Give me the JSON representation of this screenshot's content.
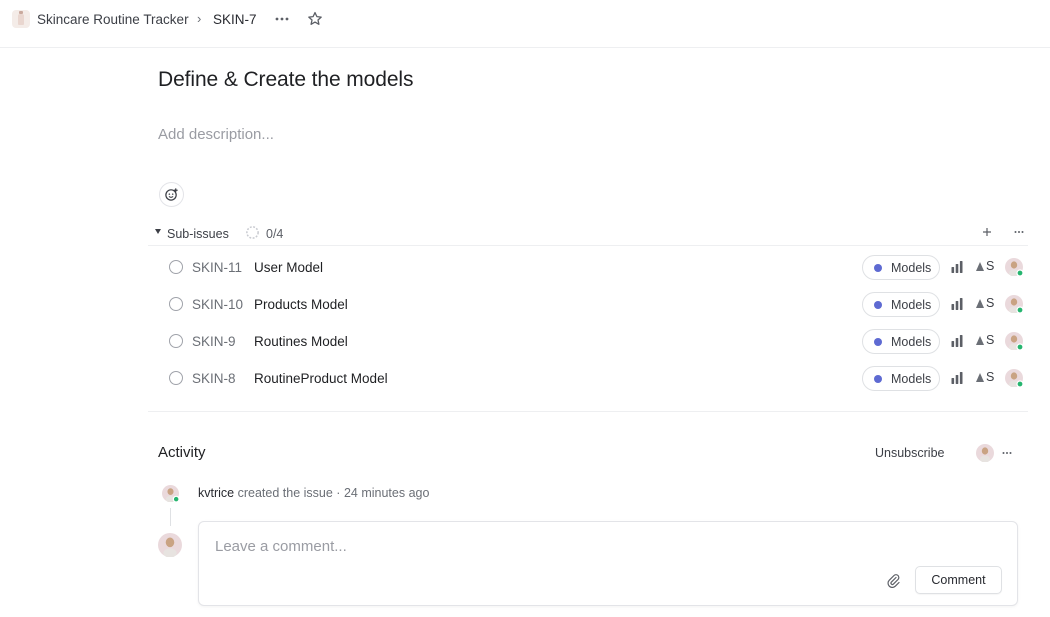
{
  "breadcrumb": {
    "project": "Skincare Routine Tracker",
    "separator": "›",
    "issue_key": "SKIN-7"
  },
  "icons": {
    "project": "skincare-bottle-icon",
    "more": "more-horizontal-icon",
    "favorite": "star-icon",
    "reaction": "add-reaction-icon",
    "progress": "progress-ring-icon",
    "add": "plus-icon",
    "priority": "priority-bars-icon",
    "estimate": "estimate-icon",
    "attach": "paperclip-icon"
  },
  "issue": {
    "title": "Define & Create the models",
    "description_placeholder": "Add description..."
  },
  "sub_issues": {
    "label": "Sub-issues",
    "count": "0/4",
    "progress": 0,
    "items": [
      {
        "key": "SKIN-11",
        "title": "User Model",
        "label": "Models",
        "estimate": "S"
      },
      {
        "key": "SKIN-10",
        "title": "Products Model",
        "label": "Models",
        "estimate": "S"
      },
      {
        "key": "SKIN-9",
        "title": "Routines Model",
        "label": "Models",
        "estimate": "S"
      },
      {
        "key": "SKIN-8",
        "title": "RoutineProduct Model",
        "label": "Models",
        "estimate": "S"
      }
    ]
  },
  "activity": {
    "title": "Activity",
    "unsubscribe_label": "Unsubscribe",
    "events": [
      {
        "user": "kvtrice",
        "action": "created the issue",
        "separator": "·",
        "time": "24 minutes ago"
      }
    ]
  },
  "comment": {
    "placeholder": "Leave a comment...",
    "submit_label": "Comment"
  },
  "colors": {
    "label_models": "#5e6ad2",
    "online": "#26b56f",
    "avatar_bg": "#ead9dc"
  }
}
